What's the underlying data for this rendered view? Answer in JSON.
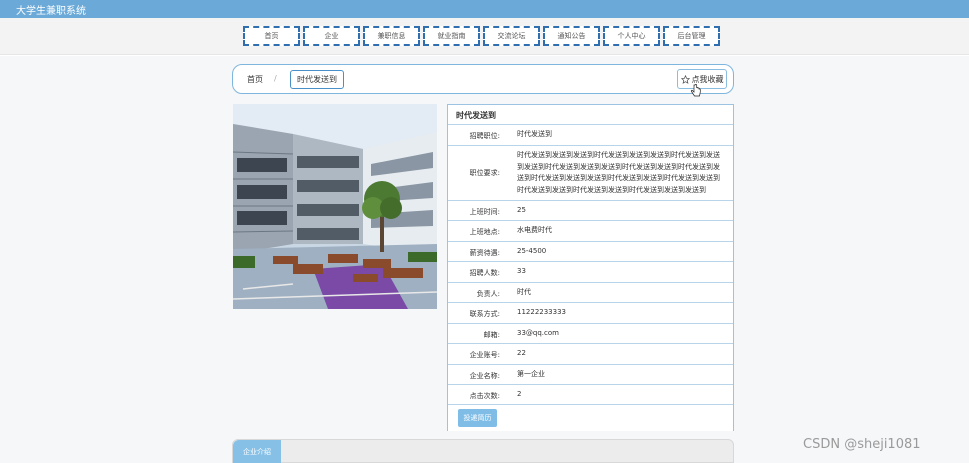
{
  "site": {
    "title": "大学生兼职系统"
  },
  "nav": {
    "items": [
      {
        "label": "首页"
      },
      {
        "label": "企业"
      },
      {
        "label": "兼职信息"
      },
      {
        "label": "就业指南"
      },
      {
        "label": "交流论坛"
      },
      {
        "label": "通知公告"
      },
      {
        "label": "个人中心"
      },
      {
        "label": "后台管理"
      }
    ]
  },
  "breadcrumb": {
    "home": "首页",
    "separator": "/",
    "current": "时代发送到"
  },
  "favorite": {
    "label": "点我收藏",
    "icon": "star-icon"
  },
  "detail": {
    "title": "时代发送到",
    "fields": [
      {
        "label": "招聘职位:",
        "value": "时代发送到"
      },
      {
        "label": "职位要求:",
        "value": "时代发送到发送到发送到时代发送到发送到发送到时代发送到发送到发送到时代发送到发送到发送到时代发送到发送到时代发送到发送到时代发送到发送到发送到时代发送到发送到时代发送到发送到时代发送到发送到时代发送到发送到时代发送到发送到发送到"
      },
      {
        "label": "上班时间:",
        "value": "25"
      },
      {
        "label": "上班地点:",
        "value": "水电费时代"
      },
      {
        "label": "薪资待遇:",
        "value": "25-4500"
      },
      {
        "label": "招聘人数:",
        "value": "33"
      },
      {
        "label": "负责人:",
        "value": "时代"
      },
      {
        "label": "联系方式:",
        "value": "11222233333"
      },
      {
        "label": "邮箱:",
        "value": "33@qq.com"
      },
      {
        "label": "企业账号:",
        "value": "22"
      },
      {
        "label": "企业名称:",
        "value": "第一企业"
      },
      {
        "label": "点击次数:",
        "value": "2"
      }
    ],
    "apply_label": "投递简历"
  },
  "company": {
    "tab_label": "企业介绍"
  },
  "watermark": "CSDN @sheji1081"
}
